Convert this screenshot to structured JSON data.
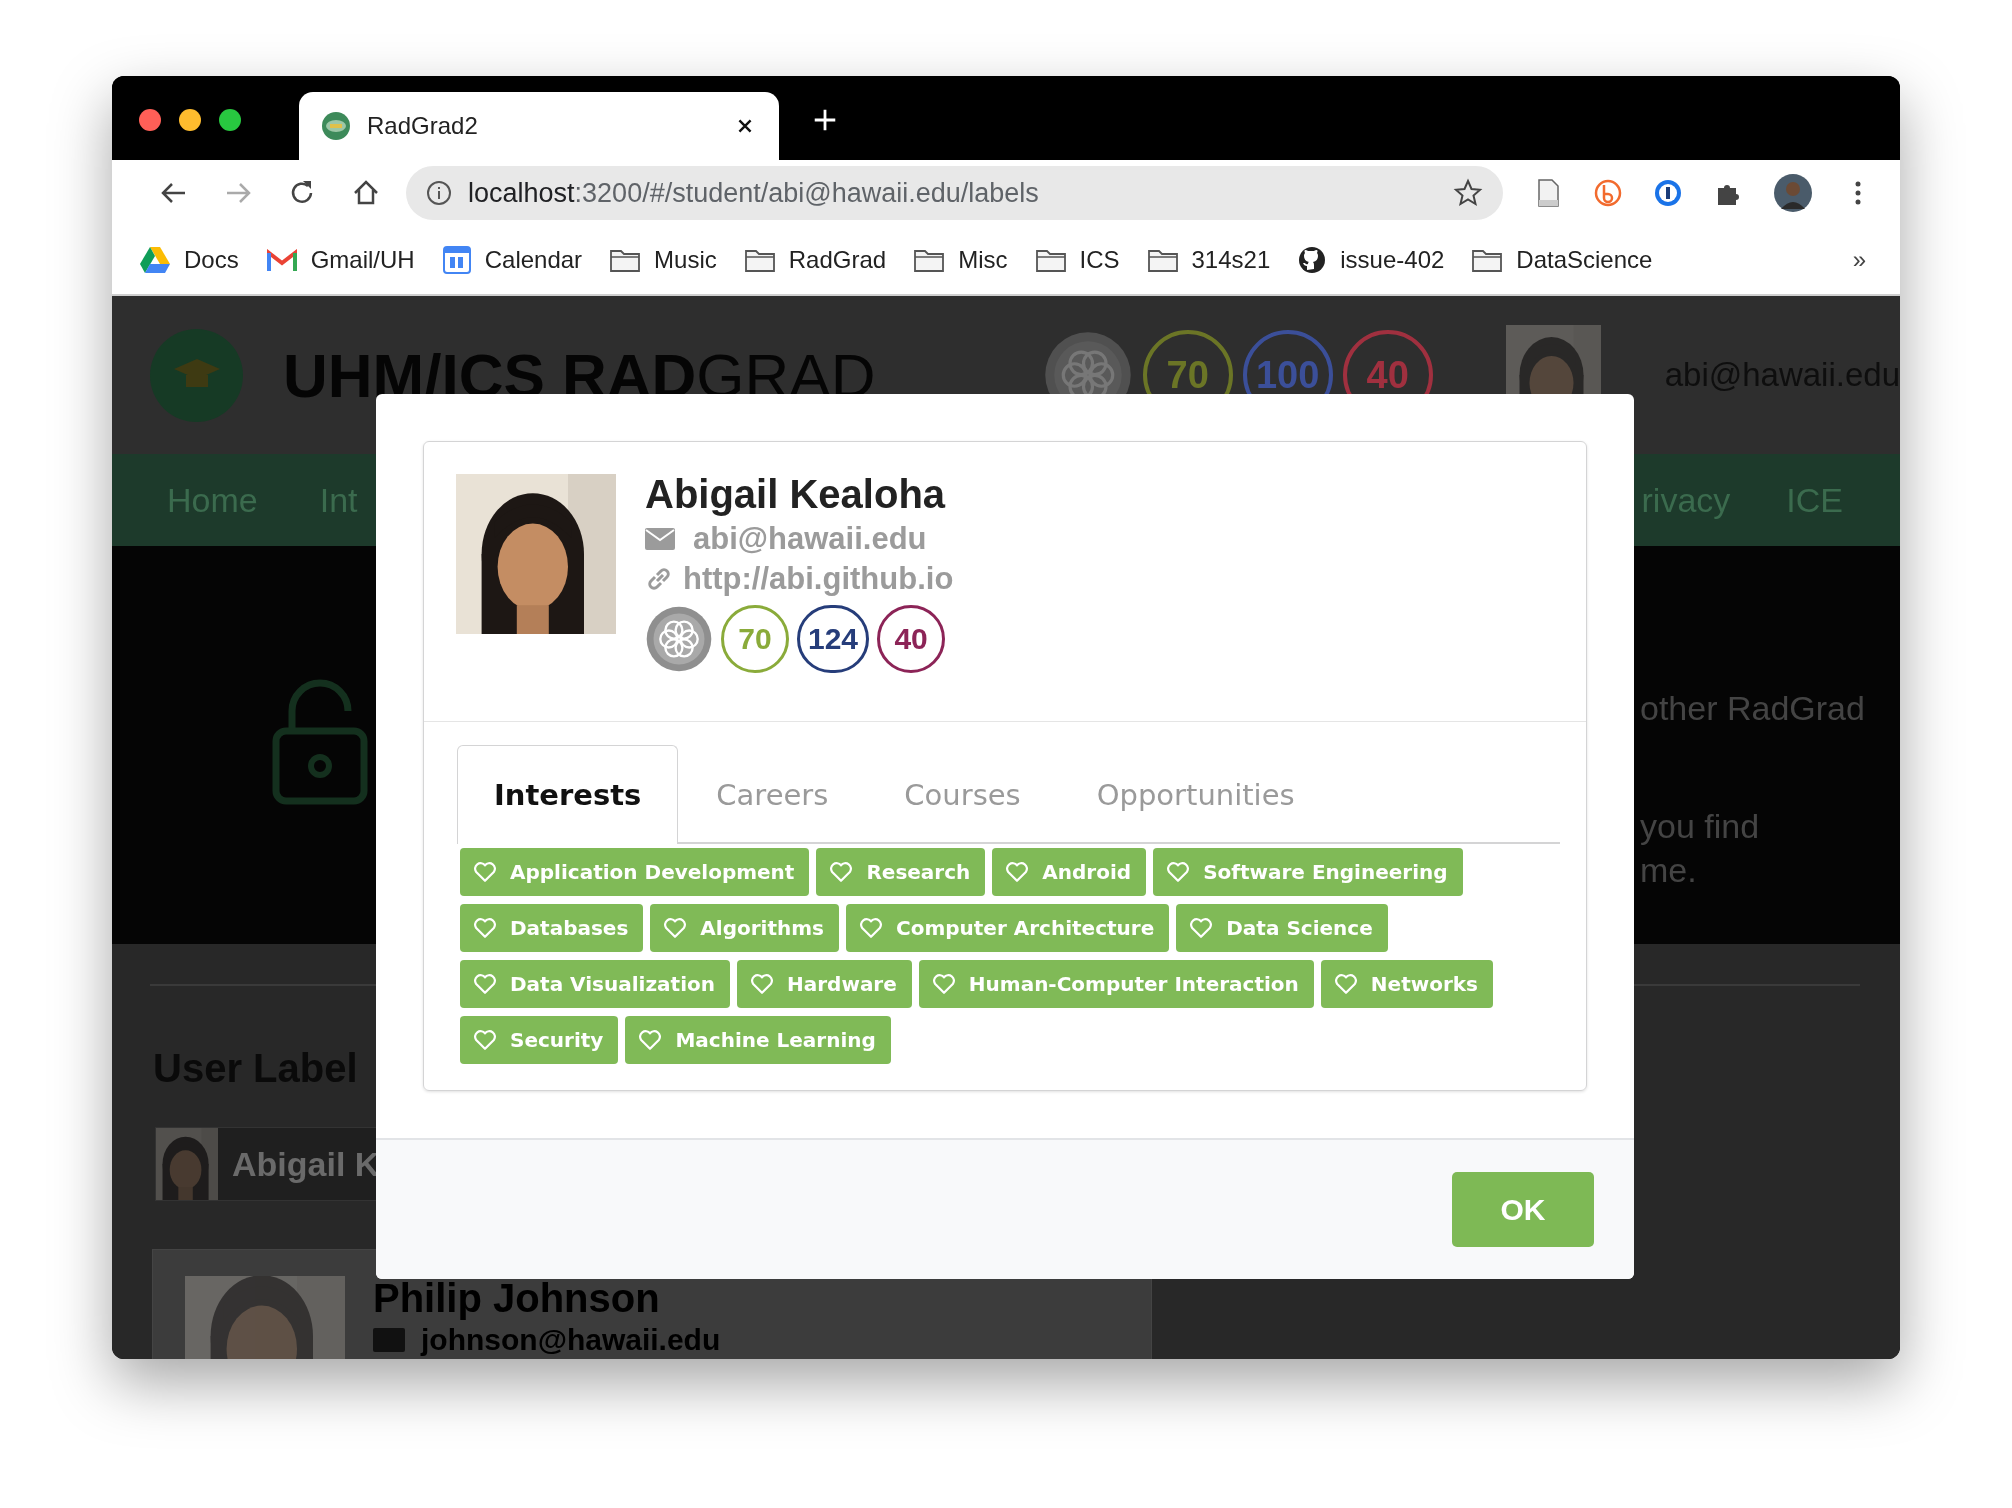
{
  "browser": {
    "tab_title": "RadGrad2",
    "url_host": "localhost",
    "url_path": ":3200/#/student/abi@hawaii.edu/labels",
    "bookmarks": [
      {
        "label": "Docs",
        "kind": "drive"
      },
      {
        "label": "Gmail/UH",
        "kind": "gmail"
      },
      {
        "label": "Calendar",
        "kind": "calendar"
      },
      {
        "label": "Music",
        "kind": "folder"
      },
      {
        "label": "RadGrad",
        "kind": "folder"
      },
      {
        "label": "Misc",
        "kind": "folder"
      },
      {
        "label": "ICS",
        "kind": "folder"
      },
      {
        "label": "314s21",
        "kind": "folder"
      },
      {
        "label": "issue-402",
        "kind": "github"
      },
      {
        "label": "DataScience",
        "kind": "folder"
      }
    ],
    "more": "»"
  },
  "background_page": {
    "title": "**UHM/ICS RAD**GRAD",
    "header_badges": [
      {
        "kind": "level"
      },
      {
        "kind": "count",
        "text": "70",
        "color": "#6b7526"
      },
      {
        "kind": "count",
        "text": "100",
        "color": "#3b4f99"
      },
      {
        "kind": "count",
        "text": "40",
        "color": "#a0303f"
      }
    ],
    "user_email": "abi@hawaii.edu",
    "nav_left": [
      "Home",
      "Int"
    ],
    "nav_right": [
      "rivacy",
      "ICE"
    ],
    "hero_lines": [
      "other RadGrad",
      "you find",
      "me."
    ],
    "section_title": "User Label",
    "user_chip": "Abigail K",
    "profile_name": "Philip Johnson",
    "profile_email": "johnson@hawaii.edu"
  },
  "modal": {
    "name": "Abigail Kealoha",
    "email": "abi@hawaii.edu",
    "website": "http://abi.github.io",
    "badges": [
      {
        "kind": "level"
      },
      {
        "kind": "count",
        "text": "70",
        "color": "#8aab3a"
      },
      {
        "kind": "count",
        "text": "124",
        "color": "#263d7a"
      },
      {
        "kind": "count",
        "text": "40",
        "color": "#8c2457"
      }
    ],
    "tabs": [
      {
        "label": "Interests",
        "selected": true
      },
      {
        "label": "Careers",
        "selected": false
      },
      {
        "label": "Courses",
        "selected": false
      },
      {
        "label": "Opportunities",
        "selected": false
      }
    ],
    "tags": [
      "Application Development",
      "Research",
      "Android",
      "Software Engineering",
      "Databases",
      "Algorithms",
      "Computer Architecture",
      "Data Science",
      "Data Visualization",
      "Hardware",
      "Human-Computer Interaction",
      "Networks",
      "Security",
      "Machine Learning"
    ],
    "ok_button": "OK"
  }
}
